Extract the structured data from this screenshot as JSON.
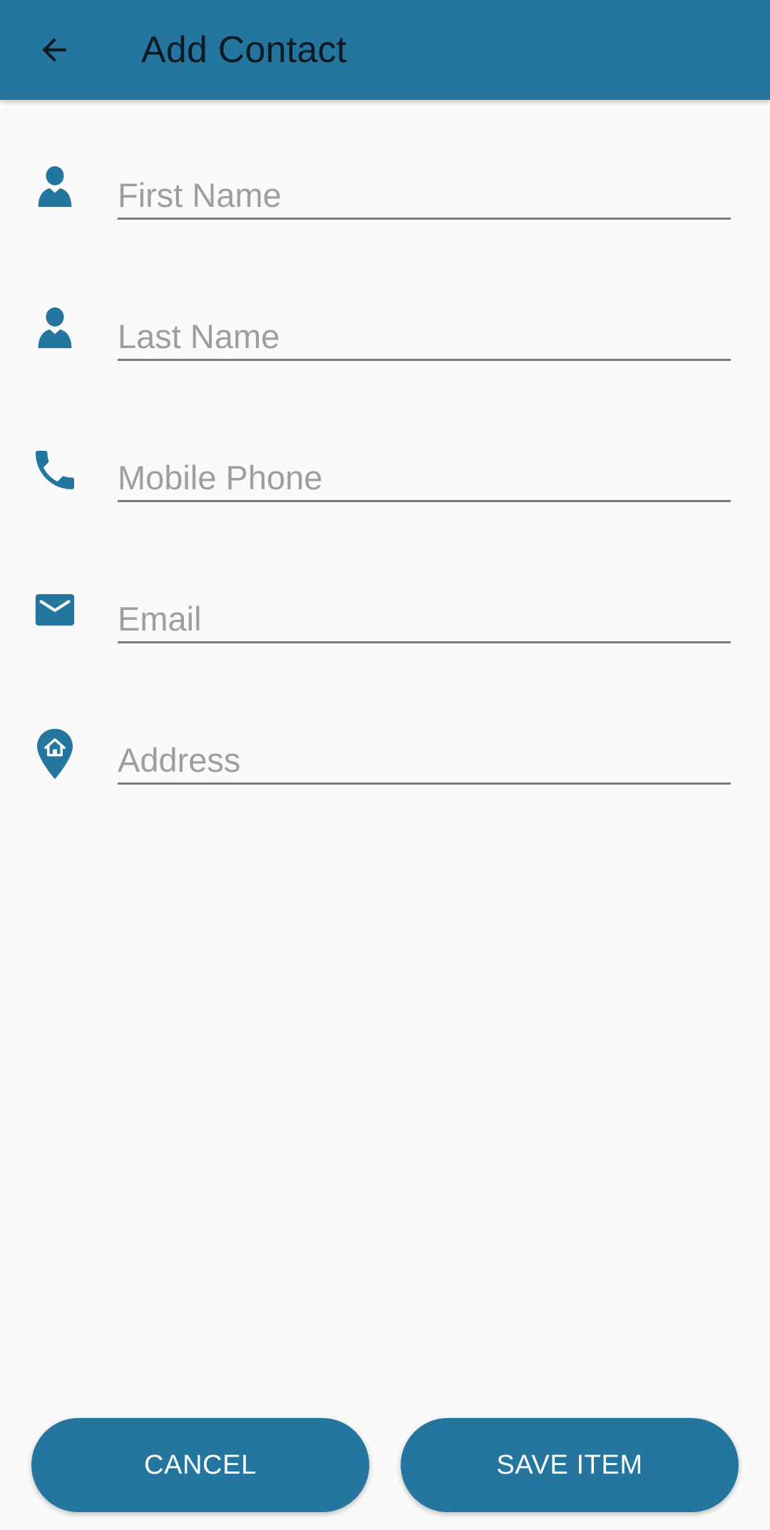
{
  "colors": {
    "primary": "#24769f",
    "background": "#fafafa",
    "title_text": "#0b1a24",
    "underline": "#7a7a7a",
    "placeholder": "#9e9e9e"
  },
  "appbar": {
    "title": "Add Contact",
    "back_icon": "arrow-left-icon"
  },
  "form": {
    "fields": [
      {
        "icon": "person-icon",
        "placeholder": "First Name",
        "value": ""
      },
      {
        "icon": "person-icon",
        "placeholder": "Last Name",
        "value": ""
      },
      {
        "icon": "phone-icon",
        "placeholder": "Mobile Phone",
        "value": ""
      },
      {
        "icon": "mail-icon",
        "placeholder": "Email",
        "value": ""
      },
      {
        "icon": "home-pin-icon",
        "placeholder": "Address",
        "value": ""
      }
    ]
  },
  "actions": {
    "cancel_label": "CANCEL",
    "save_label": "SAVE ITEM"
  }
}
